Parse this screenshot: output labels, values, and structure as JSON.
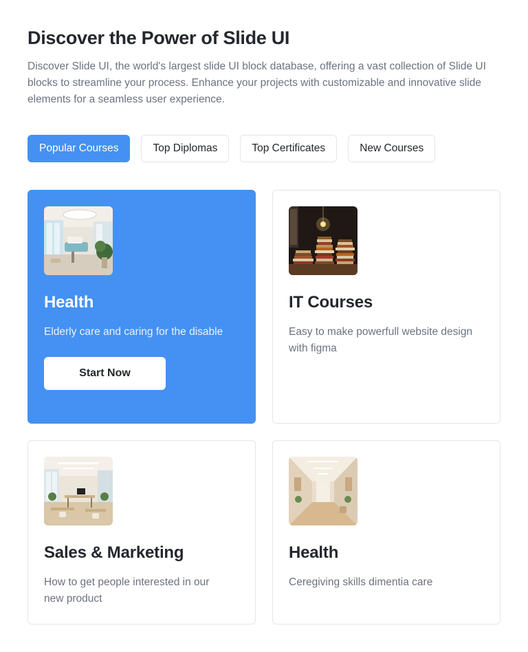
{
  "header": {
    "title": "Discover the Power of Slide UI",
    "description": "Discover Slide UI, the world's largest slide UI block database, offering a vast collection of Slide UI blocks to streamline your process. Enhance your projects with customizable and innovative slide elements for a seamless user experience."
  },
  "tabs": [
    {
      "label": "Popular Courses",
      "active": true
    },
    {
      "label": "Top Diplomas",
      "active": false
    },
    {
      "label": "Top Certificates",
      "active": false
    },
    {
      "label": "New Courses",
      "active": false
    }
  ],
  "cards": [
    {
      "title": "Health",
      "text": "Elderly care and caring for the disable",
      "button": "Start Now",
      "image": "bright-clinic-interior-image",
      "active": true
    },
    {
      "title": "IT Courses",
      "text": "Easy to make powerfull website design with figma",
      "image": "stacked-books-image",
      "active": false
    },
    {
      "title": "Sales & Marketing",
      "text": "How to get people interested in our new product",
      "image": "office-interior-image",
      "active": false
    },
    {
      "title": "Health",
      "text": "Ceregiving skills dimentia care",
      "image": "hospital-corridor-image",
      "active": false
    }
  ],
  "colors": {
    "accent": "#4491f3",
    "heading": "#24272d",
    "body": "#6b7280",
    "border": "#e3e5e8"
  }
}
